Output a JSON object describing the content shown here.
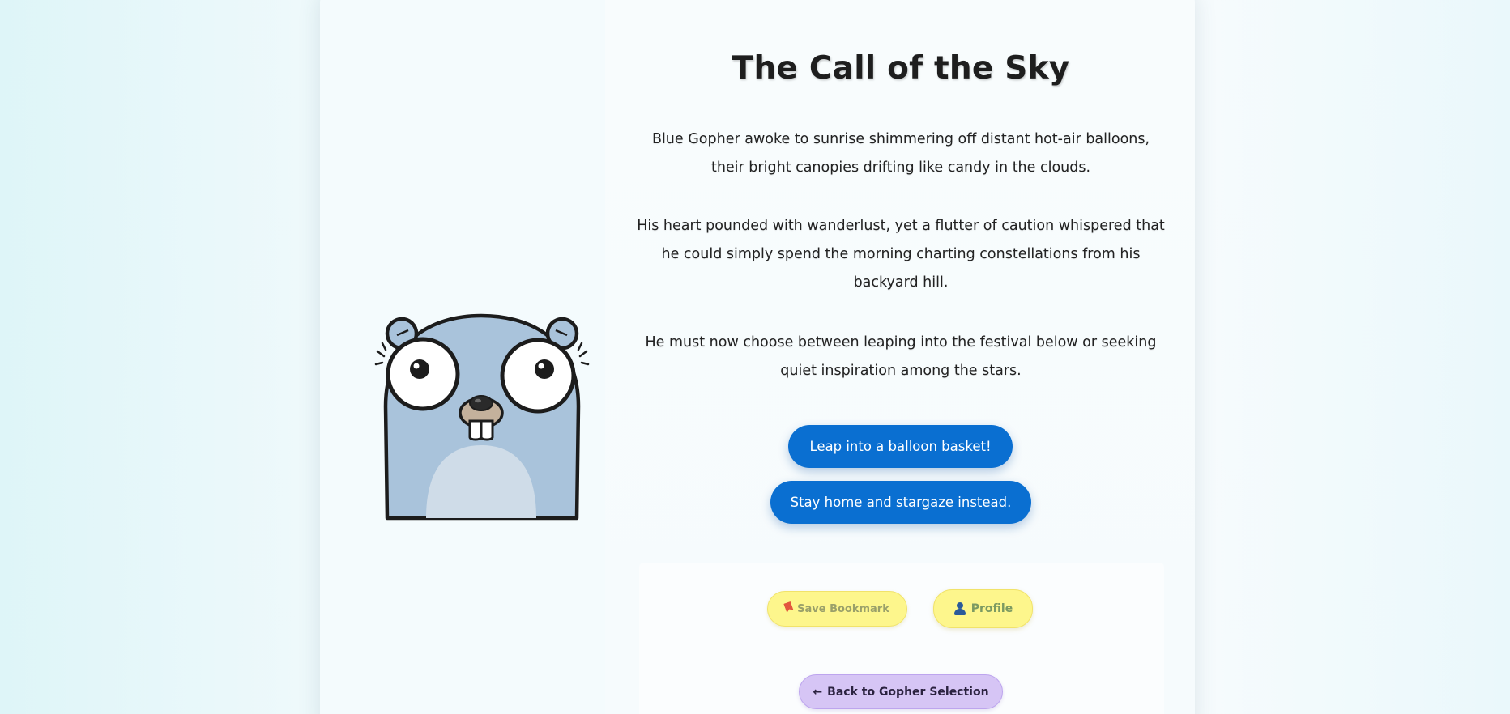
{
  "story": {
    "title": "The Call of the Sky",
    "paragraphs": [
      "Blue Gopher awoke to sunrise shimmering off distant hot-air balloons, their bright canopies drifting like candy in the clouds.",
      "His heart pounded with wanderlust, yet a flutter of caution whispered that he could simply spend the morning charting constellations from his backyard hill.",
      "He must now choose between leaping into the festival below or seeking quiet inspiration among the stars."
    ]
  },
  "choices": [
    {
      "label": "Leap into a balloon basket!"
    },
    {
      "label": "Stay home and stargaze instead."
    }
  ],
  "footer": {
    "bookmark_label": "Save Bookmark",
    "bookmark_icon": "bookmark-icon",
    "profile_label": "Profile",
    "profile_icon": "person-icon",
    "back_arrow": "←",
    "back_label": "Back to Gopher Selection"
  },
  "illustration": {
    "subject": "gopher-mascot",
    "colors": {
      "body": "#a9c3db",
      "belly": "#cfdce8",
      "outline": "#1c1c1c",
      "nose": "#c4b19c"
    }
  },
  "colors": {
    "primary_button": "#0a6fd1",
    "yellow_pill": "#fdf68c",
    "purple_pill": "#d6c5f5"
  }
}
